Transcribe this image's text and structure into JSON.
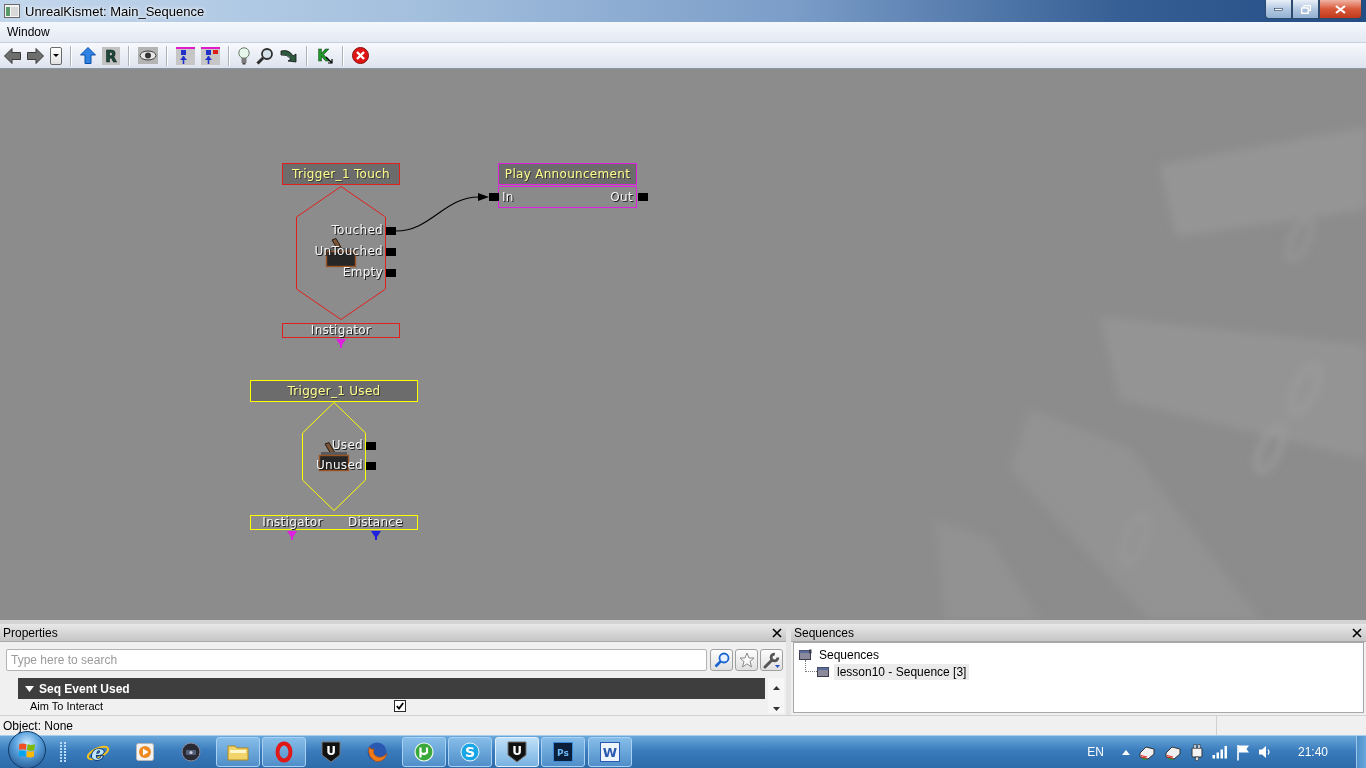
{
  "window": {
    "title": "UnrealKismet: Main_Sequence",
    "controls": [
      {
        "kind": "minimize"
      },
      {
        "kind": "restore"
      },
      {
        "kind": "close"
      }
    ]
  },
  "menu": [
    "Window"
  ],
  "toolbar": {
    "groups": [
      [
        {
          "kind": "back"
        },
        {
          "kind": "forward"
        },
        {
          "kind": "dropdown"
        }
      ],
      [
        {
          "kind": "up"
        },
        {
          "kind": "letter",
          "glyph": "R"
        }
      ],
      [
        {
          "kind": "eye"
        }
      ],
      [
        {
          "kind": "pin"
        },
        {
          "kind": "pin-flag"
        }
      ],
      [
        {
          "kind": "bulb"
        },
        {
          "kind": "zoom"
        },
        {
          "kind": "curve"
        }
      ],
      [
        {
          "kind": "letter-arrow",
          "glyph": "K"
        }
      ],
      [
        {
          "kind": "stop"
        }
      ]
    ]
  },
  "canvas": {
    "nodes": [
      {
        "kind": "event",
        "title": "Trigger_1 Touch",
        "color": "#e02020",
        "outputs": [
          {
            "label": "Touched",
            "connected": true
          },
          {
            "label": "UnTouched",
            "connected": false
          },
          {
            "label": "Empty",
            "connected": false
          }
        ],
        "variables": [
          {
            "label": "Instigator",
            "color": "#e020e0"
          }
        ]
      },
      {
        "kind": "action",
        "title": "Play Announcement",
        "color": "#e020e0",
        "inputs": [
          {
            "label": "In",
            "connected": true
          }
        ],
        "outputs": [
          {
            "label": "Out",
            "connected": false
          }
        ]
      },
      {
        "kind": "event",
        "title": "Trigger_1 Used",
        "color": "#ffff00",
        "outputs": [
          {
            "label": "Used",
            "connected": false
          },
          {
            "label": "Unused",
            "connected": false
          }
        ],
        "variables": [
          {
            "label": "Instigator",
            "color": "#e020e0"
          },
          {
            "label": "Distance",
            "color": "#2020e0"
          }
        ]
      }
    ]
  },
  "properties": {
    "title": "Properties",
    "search": {
      "placeholder": "Type here to search"
    },
    "search_buttons": [
      {
        "kind": "search"
      },
      {
        "kind": "favorite"
      },
      {
        "kind": "options"
      }
    ],
    "categories": [
      {
        "label": "Seq Event Used",
        "expanded": true,
        "rows": [
          {
            "label": "Aim To Interact",
            "kind": "checkbox",
            "checked": true
          }
        ]
      }
    ]
  },
  "sequences": {
    "title": "Sequences",
    "tree": [
      {
        "label": "Sequences",
        "selected": false,
        "children": [
          {
            "label": "lesson10 - Sequence [3]",
            "selected": true
          }
        ]
      }
    ]
  },
  "status_bar": {
    "text": "Object: None"
  },
  "taskbar": {
    "apps": [
      {
        "kind": "e-logo",
        "glyph": "e",
        "running": false,
        "selected": false
      },
      {
        "kind": "play",
        "running": false,
        "selected": false
      },
      {
        "kind": "webcam",
        "running": false,
        "selected": false
      },
      {
        "kind": "folder",
        "running": true,
        "selected": false
      },
      {
        "kind": "ring",
        "running": true,
        "selected": false
      },
      {
        "kind": "u-shield",
        "glyph": "U",
        "running": false,
        "selected": false
      },
      {
        "kind": "fox-globe",
        "running": false,
        "selected": false
      },
      {
        "kind": "mu-circle",
        "running": true,
        "selected": false
      },
      {
        "kind": "s-circle",
        "glyph": "S",
        "running": true,
        "selected": false
      },
      {
        "kind": "u-shield",
        "glyph": "U",
        "running": true,
        "selected": true
      },
      {
        "kind": "tile-dark",
        "glyph": "Ps",
        "running": true,
        "selected": false
      },
      {
        "kind": "tile-light",
        "glyph": "W",
        "running": true,
        "selected": false
      }
    ],
    "tray": {
      "language": "EN",
      "icons": [
        {
          "kind": "device"
        },
        {
          "kind": "device"
        },
        {
          "kind": "plug"
        },
        {
          "kind": "signal"
        },
        {
          "kind": "flag"
        },
        {
          "kind": "speaker"
        }
      ],
      "clock": "21:40"
    }
  }
}
